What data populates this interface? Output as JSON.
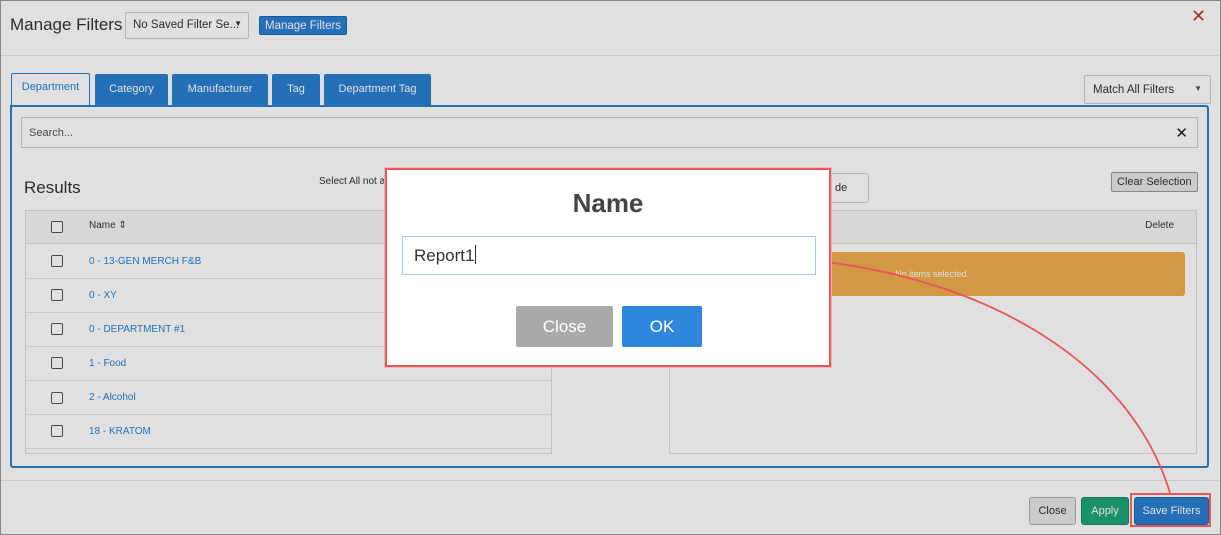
{
  "header": {
    "title": "Manage Filters",
    "saved_filter_value": "No Saved Filter Se...",
    "manage_filters_label": "Manage Filters",
    "close_glyph": "✕"
  },
  "tabs": [
    {
      "label": "Department",
      "active": true
    },
    {
      "label": "Category"
    },
    {
      "label": "Manufacturer"
    },
    {
      "label": "Tag"
    },
    {
      "label": "Department Tag"
    }
  ],
  "match_select": {
    "value": "Match All Filters"
  },
  "search": {
    "placeholder": "Search...",
    "clear_glyph": "✕"
  },
  "results": {
    "title": "Results",
    "select_all_label": "Select All not a",
    "column_name": "Name ⇕",
    "rows": [
      "0 - 13-GEN MERCH F&B",
      "0 - XY",
      "0 - DEPARTMENT #1",
      "1 - Food",
      "2 - Alcohol",
      "18 - KRATOM"
    ]
  },
  "selection": {
    "pane_button_label": "de",
    "clear_selection_label": "Clear Selection",
    "column_delete": "Delete",
    "empty_message": "No items selected."
  },
  "footer": {
    "close_label": "Close",
    "apply_label": "Apply",
    "save_label": "Save Filters"
  },
  "dialog": {
    "title": "Name",
    "input_value": "Report1",
    "close_label": "Close",
    "ok_label": "OK"
  },
  "colors": {
    "primary": "#2a7fd0",
    "success": "#1fa67a",
    "warning": "#f0ad4e",
    "annotation": "#e8555a"
  }
}
